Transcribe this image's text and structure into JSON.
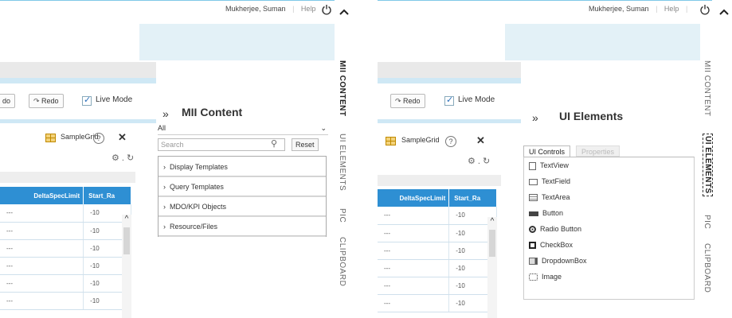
{
  "header": {
    "user": "Mukherjee, Suman",
    "help": "Help"
  },
  "toolbar": {
    "undo_partial": "do",
    "redo": "Redo",
    "live_mode": "Live Mode"
  },
  "grid": {
    "title": "SampleGrid",
    "help": "?",
    "columns": [
      "DeltaSpecLimit",
      "Start_Ra"
    ],
    "rows": [
      [
        "---",
        "-10"
      ],
      [
        "---",
        "-10"
      ],
      [
        "---",
        "-10"
      ],
      [
        "---",
        "-10"
      ],
      [
        "---",
        "-10"
      ],
      [
        "---",
        "-10"
      ]
    ]
  },
  "left_panel": {
    "title": "MII Content",
    "filter": "All",
    "search_placeholder": "Search",
    "reset": "Reset",
    "items": [
      "Display Templates",
      "Query Templates",
      "MDO/KPI Objects",
      "Resource/Files"
    ]
  },
  "right_panel": {
    "title": "UI Elements",
    "tabs": [
      "UI Controls",
      "Properties"
    ],
    "items": [
      {
        "label": "TextView",
        "icon": "textview-icon"
      },
      {
        "label": "TextField",
        "icon": "textfield-icon"
      },
      {
        "label": "TextArea",
        "icon": "textarea-icon"
      },
      {
        "label": "Button",
        "icon": "button-icon"
      },
      {
        "label": "Radio Button",
        "icon": "radio-icon"
      },
      {
        "label": "CheckBox",
        "icon": "checkbox-icon"
      },
      {
        "label": "DropdownBox",
        "icon": "dropdown-icon"
      },
      {
        "label": "Image",
        "icon": "image-icon"
      }
    ]
  },
  "vertical_tabs": [
    "MII CONTENT",
    "UI ELEMENTS",
    "PIC",
    "CLIPBOARD"
  ],
  "colors": {
    "grid_header": "#2e8fd3",
    "accent": "#2a6ebb",
    "band": "#e3f1f7"
  }
}
